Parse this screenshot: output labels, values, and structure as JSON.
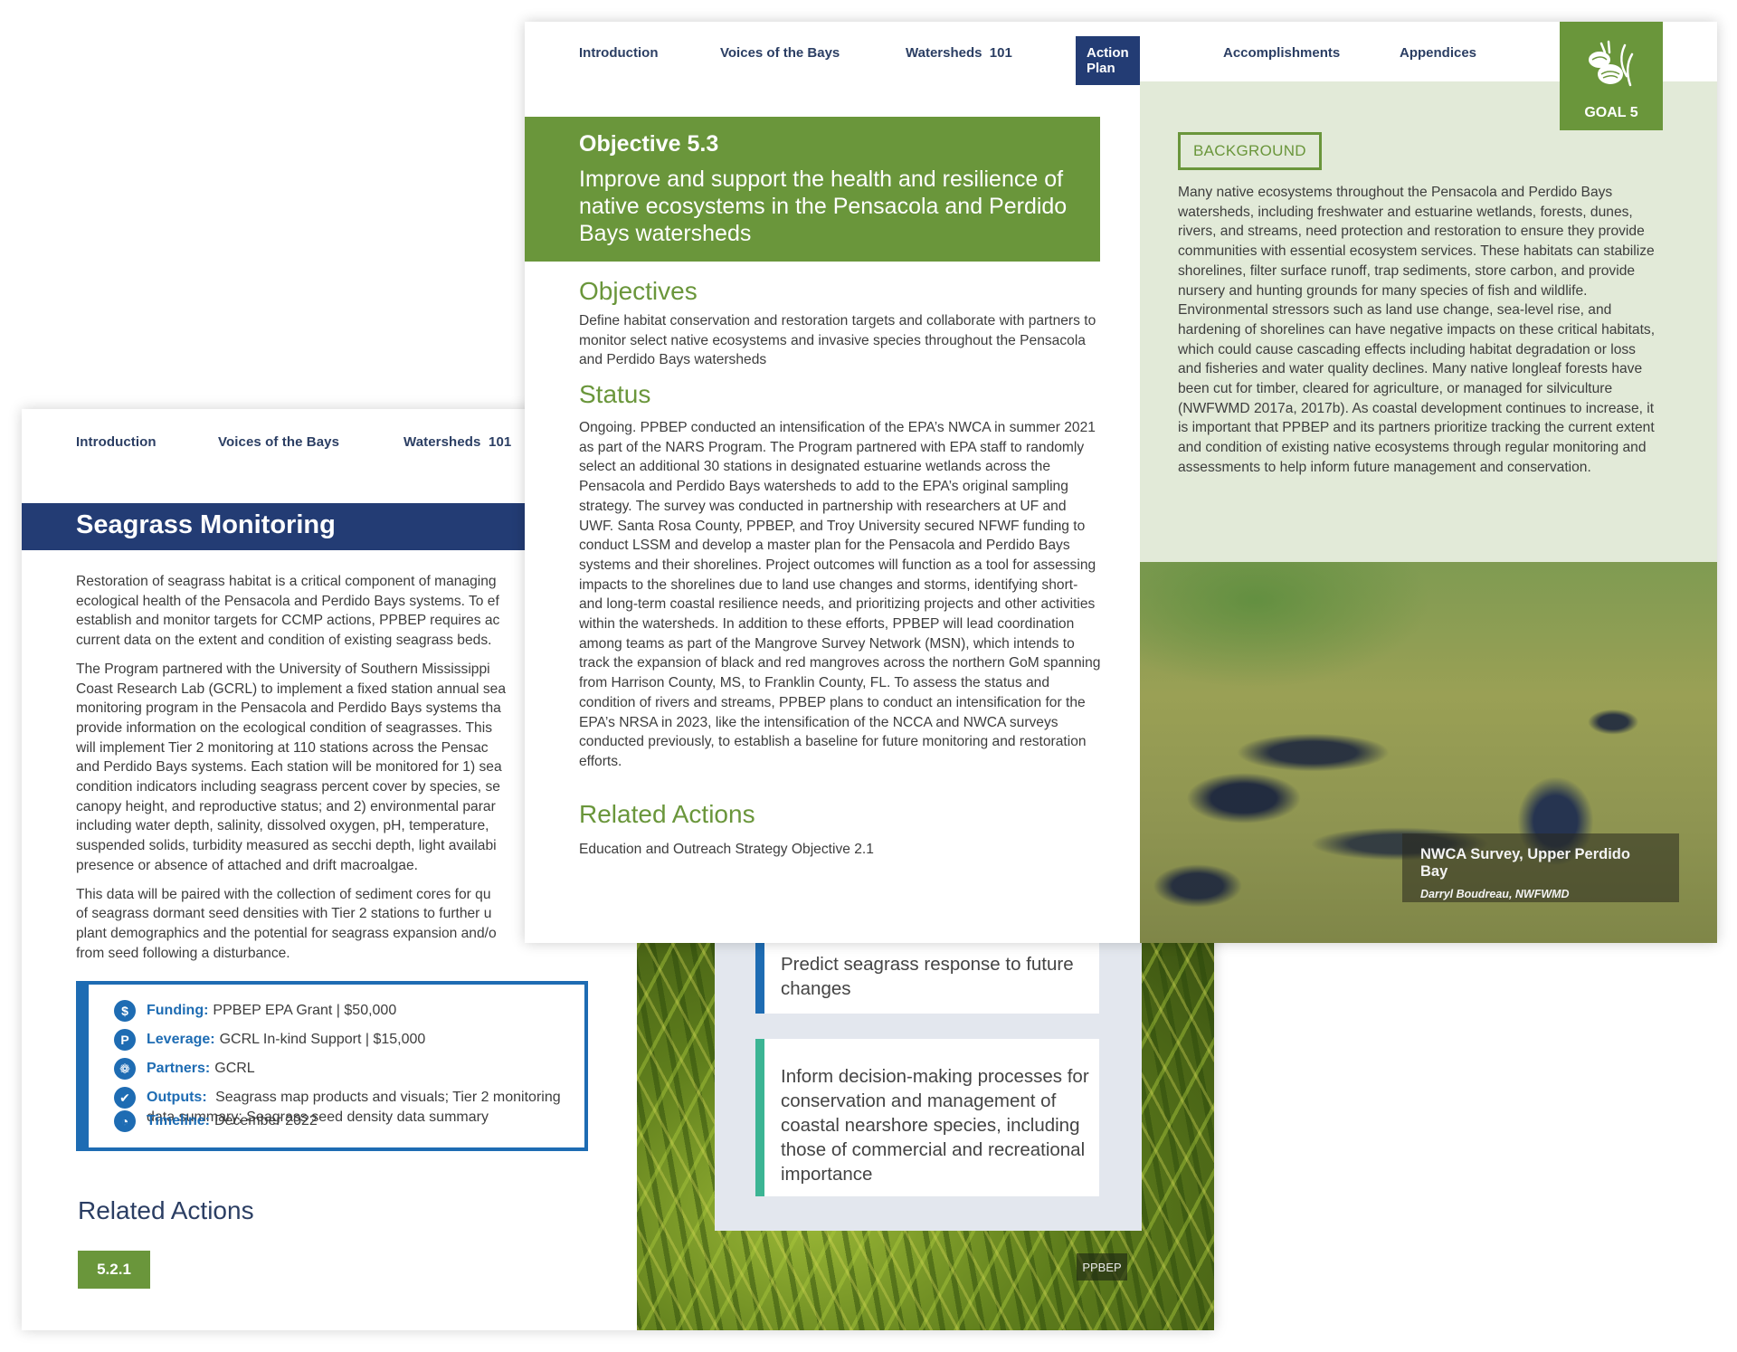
{
  "nav": {
    "items": [
      "Introduction",
      "Voices of the Bays",
      "Watersheds  101",
      "Action Plan",
      "Accomplishments",
      "Appendices"
    ],
    "active": "Action Plan"
  },
  "back_page": {
    "title": "Seagrass Monitoring",
    "paragraphs": [
      [
        "Restoration of seagrass habitat is a critical component of managing",
        "ecological health of the Pensacola and Perdido Bays systems. To ef",
        "establish and monitor targets for CCMP actions, PPBEP requires ac",
        "current data on the extent and condition of existing seagrass beds."
      ],
      [
        "The Program partnered with the University of Southern Mississippi",
        "Coast Research Lab (GCRL) to implement a fixed station annual sea",
        "monitoring program in the Pensacola and Perdido Bays systems tha",
        "provide information on the ecological condition of seagrasses. This",
        "will implement Tier 2 monitoring at 110 stations across the Pensac",
        "and Perdido Bays systems. Each station will be monitored for 1) sea",
        "condition indicators including seagrass percent cover by species, se",
        "canopy height, and reproductive status; and 2) environmental parar",
        "including water depth, salinity, dissolved oxygen, pH, temperature,",
        "suspended solids, turbidity measured as secchi depth, light availabi",
        "presence or absence of attached and drift macroalgae."
      ],
      [
        "This data will be paired with the collection of sediment cores for qu",
        "of seagrass dormant seed densities with Tier 2 stations to further u",
        "plant demographics and the potential for seagrass expansion and/o",
        "from seed following a disturbance."
      ]
    ],
    "info": [
      {
        "icon": "dollar-icon",
        "glyph": "$",
        "label": "Funding:",
        "value": "PPBEP EPA Grant | $50,000"
      },
      {
        "icon": "leverage-icon",
        "glyph": "P",
        "label": "Leverage:",
        "value": "GCRL In-kind Support | $15,000"
      },
      {
        "icon": "partners-icon",
        "glyph": "❁",
        "label": "Partners:",
        "value": "GCRL"
      },
      {
        "icon": "check-icon",
        "glyph": "✔",
        "label": "Outputs:",
        "value": "Seagrass map products and visuals; Tier 2 monitoring",
        "value2": "data summary; Seagrass seed density data summary"
      },
      {
        "icon": "clock-icon",
        "glyph": "◔",
        "label": "Timeline:",
        "value": "December 2022"
      }
    ],
    "related_title": "Related Actions",
    "related_chip": "5.2.1",
    "goal_cards": [
      "Predict seagrass response to future changes",
      "Inform decision-making processes for conservation and management of coastal nearshore species, including those of commercial and recreational importance"
    ],
    "photo_credit": "PPBEP"
  },
  "front_page": {
    "goal_label": "GOAL 5",
    "objective_number": "Objective 5.3",
    "objective_title": "Improve and support the health and resilience of native ecosystems in the Pensacola and Perdido Bays watersheds",
    "objectives_heading": "Objectives",
    "objectives_text": "Define habitat conservation and restoration targets and collaborate with partners to monitor select native ecosystems and invasive species throughout the Pensacola and Perdido Bays watersheds",
    "status_heading": "Status",
    "status_text": "Ongoing. PPBEP conducted an intensification of the EPA’s NWCA in summer 2021 as part of the NARS Program. The Program partnered with EPA staff to randomly select an additional 30 stations in designated estuarine wetlands across the Pensacola and Perdido Bays watersheds to add to the EPA’s original sampling strategy. The survey was conducted in partnership with researchers at UF and UWF. Santa Rosa County, PPBEP, and Troy University secured NFWF funding to conduct LSSM and develop a master plan for the Pensacola and Perdido Bays systems and their shorelines. Project outcomes will function as a tool for assessing impacts to the shorelines due to land use changes and storms, identifying short- and long-term coastal resilience needs, and prioritizing projects and other activities within the watersheds. In addition to these efforts, PPBEP will lead coordination among teams as part of the Mangrove Survey Network (MSN), which intends to track the expansion of black and red mangroves across the northern GoM spanning from Harrison County, MS, to Franklin County, FL. To assess the status and condition of rivers and streams, PPBEP plans to conduct an intensification for the EPA’s NRSA in 2023, like the intensification of the NCCA and NWCA surveys conducted previously, to establish a baseline for future monitoring and restoration efforts.",
    "related_heading": "Related Actions",
    "related_text": "Education and Outreach Strategy Objective 2.1",
    "background_tag": "BACKGROUND",
    "background_text": "Many native ecosystems throughout the Pensacola and Perdido Bays watersheds, including freshwater and estuarine wetlands, forests, dunes, rivers, and streams, need protection and restoration to ensure they provide communities with essential ecosystem services. These habitats can stabilize shorelines, filter surface runoff, trap sediments, store carbon, and provide nursery and hunting grounds for many species of fish and wildlife. Environmental stressors such as land use change, sea-level rise, and hardening of shorelines can have negative impacts on these critical habitats, which could cause cascading effects including habitat degradation or loss and fisheries and water quality declines. Many native longleaf forests have been cut for timber, cleared for agriculture, or managed for silviculture (NWFWMD 2017a, 2017b). As coastal development continues to increase, it is important that PPBEP and its partners prioritize tracking the current extent and condition of existing native ecosystems through regular monitoring and assessments to help inform future management and conservation.",
    "photo_caption": "NWCA Survey, Upper Perdido Bay",
    "photo_credit": "Darryl Boudreau, NWFWMD"
  },
  "colors": {
    "navy": "#233c74",
    "green": "#6a963b",
    "light_green_bg": "#e2ead8",
    "blue_accent": "#1e6cb3",
    "teal_accent": "#3cb594"
  }
}
